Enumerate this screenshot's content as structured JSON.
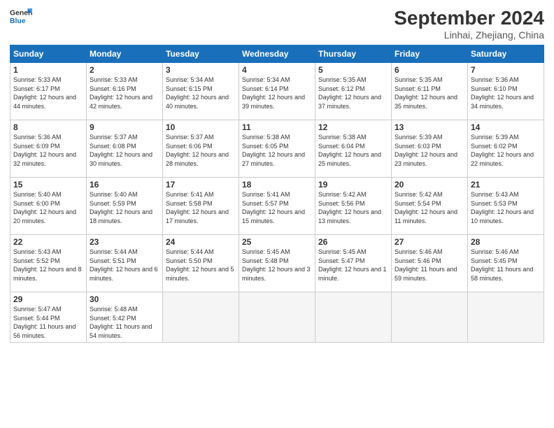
{
  "header": {
    "logo_general": "General",
    "logo_blue": "Blue",
    "month_title": "September 2024",
    "subtitle": "Linhai, Zhejiang, China"
  },
  "weekdays": [
    "Sunday",
    "Monday",
    "Tuesday",
    "Wednesday",
    "Thursday",
    "Friday",
    "Saturday"
  ],
  "weeks": [
    [
      {
        "day": "1",
        "sunrise": "Sunrise: 5:33 AM",
        "sunset": "Sunset: 6:17 PM",
        "daylight": "Daylight: 12 hours and 44 minutes."
      },
      {
        "day": "2",
        "sunrise": "Sunrise: 5:33 AM",
        "sunset": "Sunset: 6:16 PM",
        "daylight": "Daylight: 12 hours and 42 minutes."
      },
      {
        "day": "3",
        "sunrise": "Sunrise: 5:34 AM",
        "sunset": "Sunset: 6:15 PM",
        "daylight": "Daylight: 12 hours and 40 minutes."
      },
      {
        "day": "4",
        "sunrise": "Sunrise: 5:34 AM",
        "sunset": "Sunset: 6:14 PM",
        "daylight": "Daylight: 12 hours and 39 minutes."
      },
      {
        "day": "5",
        "sunrise": "Sunrise: 5:35 AM",
        "sunset": "Sunset: 6:12 PM",
        "daylight": "Daylight: 12 hours and 37 minutes."
      },
      {
        "day": "6",
        "sunrise": "Sunrise: 5:35 AM",
        "sunset": "Sunset: 6:11 PM",
        "daylight": "Daylight: 12 hours and 35 minutes."
      },
      {
        "day": "7",
        "sunrise": "Sunrise: 5:36 AM",
        "sunset": "Sunset: 6:10 PM",
        "daylight": "Daylight: 12 hours and 34 minutes."
      }
    ],
    [
      {
        "day": "8",
        "sunrise": "Sunrise: 5:36 AM",
        "sunset": "Sunset: 6:09 PM",
        "daylight": "Daylight: 12 hours and 32 minutes."
      },
      {
        "day": "9",
        "sunrise": "Sunrise: 5:37 AM",
        "sunset": "Sunset: 6:08 PM",
        "daylight": "Daylight: 12 hours and 30 minutes."
      },
      {
        "day": "10",
        "sunrise": "Sunrise: 5:37 AM",
        "sunset": "Sunset: 6:06 PM",
        "daylight": "Daylight: 12 hours and 28 minutes."
      },
      {
        "day": "11",
        "sunrise": "Sunrise: 5:38 AM",
        "sunset": "Sunset: 6:05 PM",
        "daylight": "Daylight: 12 hours and 27 minutes."
      },
      {
        "day": "12",
        "sunrise": "Sunrise: 5:38 AM",
        "sunset": "Sunset: 6:04 PM",
        "daylight": "Daylight: 12 hours and 25 minutes."
      },
      {
        "day": "13",
        "sunrise": "Sunrise: 5:39 AM",
        "sunset": "Sunset: 6:03 PM",
        "daylight": "Daylight: 12 hours and 23 minutes."
      },
      {
        "day": "14",
        "sunrise": "Sunrise: 5:39 AM",
        "sunset": "Sunset: 6:02 PM",
        "daylight": "Daylight: 12 hours and 22 minutes."
      }
    ],
    [
      {
        "day": "15",
        "sunrise": "Sunrise: 5:40 AM",
        "sunset": "Sunset: 6:00 PM",
        "daylight": "Daylight: 12 hours and 20 minutes."
      },
      {
        "day": "16",
        "sunrise": "Sunrise: 5:40 AM",
        "sunset": "Sunset: 5:59 PM",
        "daylight": "Daylight: 12 hours and 18 minutes."
      },
      {
        "day": "17",
        "sunrise": "Sunrise: 5:41 AM",
        "sunset": "Sunset: 5:58 PM",
        "daylight": "Daylight: 12 hours and 17 minutes."
      },
      {
        "day": "18",
        "sunrise": "Sunrise: 5:41 AM",
        "sunset": "Sunset: 5:57 PM",
        "daylight": "Daylight: 12 hours and 15 minutes."
      },
      {
        "day": "19",
        "sunrise": "Sunrise: 5:42 AM",
        "sunset": "Sunset: 5:56 PM",
        "daylight": "Daylight: 12 hours and 13 minutes."
      },
      {
        "day": "20",
        "sunrise": "Sunrise: 5:42 AM",
        "sunset": "Sunset: 5:54 PM",
        "daylight": "Daylight: 12 hours and 11 minutes."
      },
      {
        "day": "21",
        "sunrise": "Sunrise: 5:43 AM",
        "sunset": "Sunset: 5:53 PM",
        "daylight": "Daylight: 12 hours and 10 minutes."
      }
    ],
    [
      {
        "day": "22",
        "sunrise": "Sunrise: 5:43 AM",
        "sunset": "Sunset: 5:52 PM",
        "daylight": "Daylight: 12 hours and 8 minutes."
      },
      {
        "day": "23",
        "sunrise": "Sunrise: 5:44 AM",
        "sunset": "Sunset: 5:51 PM",
        "daylight": "Daylight: 12 hours and 6 minutes."
      },
      {
        "day": "24",
        "sunrise": "Sunrise: 5:44 AM",
        "sunset": "Sunset: 5:50 PM",
        "daylight": "Daylight: 12 hours and 5 minutes."
      },
      {
        "day": "25",
        "sunrise": "Sunrise: 5:45 AM",
        "sunset": "Sunset: 5:48 PM",
        "daylight": "Daylight: 12 hours and 3 minutes."
      },
      {
        "day": "26",
        "sunrise": "Sunrise: 5:45 AM",
        "sunset": "Sunset: 5:47 PM",
        "daylight": "Daylight: 12 hours and 1 minute."
      },
      {
        "day": "27",
        "sunrise": "Sunrise: 5:46 AM",
        "sunset": "Sunset: 5:46 PM",
        "daylight": "Daylight: 11 hours and 59 minutes."
      },
      {
        "day": "28",
        "sunrise": "Sunrise: 5:46 AM",
        "sunset": "Sunset: 5:45 PM",
        "daylight": "Daylight: 11 hours and 58 minutes."
      }
    ],
    [
      {
        "day": "29",
        "sunrise": "Sunrise: 5:47 AM",
        "sunset": "Sunset: 5:44 PM",
        "daylight": "Daylight: 11 hours and 56 minutes."
      },
      {
        "day": "30",
        "sunrise": "Sunrise: 5:48 AM",
        "sunset": "Sunset: 5:42 PM",
        "daylight": "Daylight: 11 hours and 54 minutes."
      },
      {
        "day": "",
        "sunrise": "",
        "sunset": "",
        "daylight": ""
      },
      {
        "day": "",
        "sunrise": "",
        "sunset": "",
        "daylight": ""
      },
      {
        "day": "",
        "sunrise": "",
        "sunset": "",
        "daylight": ""
      },
      {
        "day": "",
        "sunrise": "",
        "sunset": "",
        "daylight": ""
      },
      {
        "day": "",
        "sunrise": "",
        "sunset": "",
        "daylight": ""
      }
    ]
  ]
}
